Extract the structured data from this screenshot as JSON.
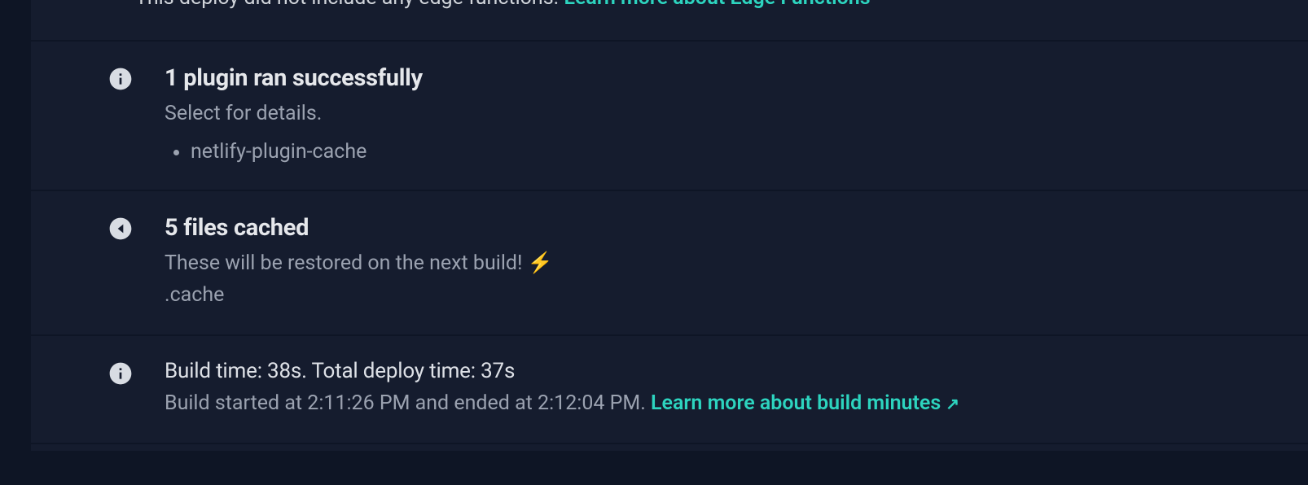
{
  "top_partial": {
    "obscured_prefix": "This deploy did not include any edge functions. ",
    "link_text": "Learn more about Edge Functions"
  },
  "plugins": {
    "heading": "1 plugin ran successfully",
    "subtext": "Select for details.",
    "items": [
      "netlify-plugin-cache"
    ]
  },
  "cache": {
    "heading": "5 files cached",
    "subtext": "These will be restored on the next build! ",
    "emoji": "⚡",
    "path": ".cache"
  },
  "build": {
    "main_line": "Build time: 38s. Total deploy time: 37s",
    "sub_line": "Build started at 2:11:26 PM and ended at 2:12:04 PM. ",
    "link_text": "Learn more about build minutes",
    "link_arrow": "↗"
  }
}
